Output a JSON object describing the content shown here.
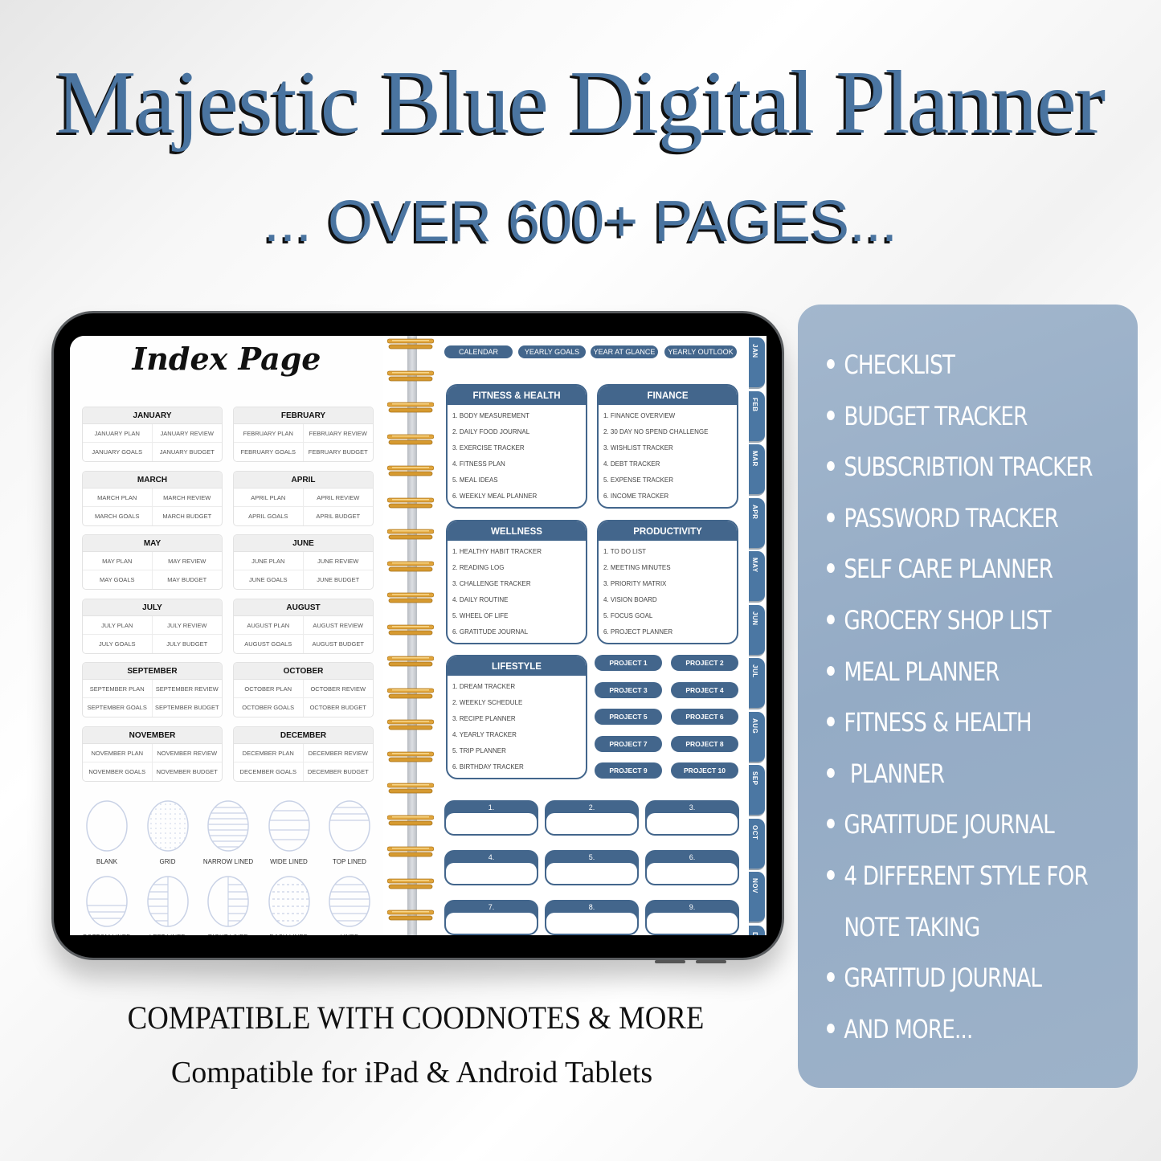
{
  "header": {
    "title": "Majestic Blue Digital Planner",
    "subtitle": "... OVER 600+ PAGES..."
  },
  "colors": {
    "accent": "#43668c",
    "title_blue": "#4a74a0",
    "panel": "#9db2c9"
  },
  "index_page": {
    "title": "Index Page",
    "months": [
      {
        "name": "JANUARY",
        "items": [
          "JANUARY PLAN",
          "JANUARY REVIEW",
          "JANUARY GOALS",
          "JANUARY BUDGET"
        ]
      },
      {
        "name": "FEBRUARY",
        "items": [
          "FEBRUARY PLAN",
          "FEBRUARY REVIEW",
          "FEBRUARY GOALS",
          "FEBRUARY BUDGET"
        ]
      },
      {
        "name": "MARCH",
        "items": [
          "MARCH PLAN",
          "MARCH REVIEW",
          "MARCH GOALS",
          "MARCH BUDGET"
        ]
      },
      {
        "name": "APRIL",
        "items": [
          "APRIL PLAN",
          "APRIL REVIEW",
          "APRIL GOALS",
          "APRIL BUDGET"
        ]
      },
      {
        "name": "MAY",
        "items": [
          "MAY PLAN",
          "MAY REVIEW",
          "MAY GOALS",
          "MAY BUDGET"
        ]
      },
      {
        "name": "JUNE",
        "items": [
          "JUNE PLAN",
          "JUNE REVIEW",
          "JUNE GOALS",
          "JUNE BUDGET"
        ]
      },
      {
        "name": "JULY",
        "items": [
          "JULY PLAN",
          "JULY REVIEW",
          "JULY GOALS",
          "JULY BUDGET"
        ]
      },
      {
        "name": "AUGUST",
        "items": [
          "AUGUST PLAN",
          "AUGUST REVIEW",
          "AUGUST GOALS",
          "AUGUST BUDGET"
        ]
      },
      {
        "name": "SEPTEMBER",
        "items": [
          "SEPTEMBER PLAN",
          "SEPTEMBER REVIEW",
          "SEPTEMBER GOALS",
          "SEPTEMBER BUDGET"
        ]
      },
      {
        "name": "OCTOBER",
        "items": [
          "OCTOBER PLAN",
          "OCTOBER REVIEW",
          "OCTOBER GOALS",
          "OCTOBER BUDGET"
        ]
      },
      {
        "name": "NOVEMBER",
        "items": [
          "NOVEMBER PLAN",
          "NOVEMBER REVIEW",
          "NOVEMBER GOALS",
          "NOVEMBER BUDGET"
        ]
      },
      {
        "name": "DECEMBER",
        "items": [
          "DECEMBER PLAN",
          "DECEMBER REVIEW",
          "DECEMBER GOALS",
          "DECEMBER BUDGET"
        ]
      }
    ],
    "note_styles": [
      "BLANK",
      "GRID",
      "NARROW LINED",
      "WIDE LINED",
      "TOP LINED",
      "BOTTOM LINED",
      "LEFT LINED",
      "RIGHT LINED",
      "DASH LINED",
      "LINED"
    ]
  },
  "right_page": {
    "nav_buttons": [
      "CALENDAR",
      "YEARLY GOALS",
      "YEAR AT GLANCE",
      "YEARLY OUTLOOK"
    ],
    "categories": [
      {
        "title": "FITNESS & HEALTH",
        "items": [
          "1. BODY MEASUREMENT",
          "2. DAILY FOOD JOURNAL",
          "3. EXERCISE TRACKER",
          "4. FITNESS PLAN",
          "5. MEAL IDEAS",
          "6. WEEKLY MEAL PLANNER"
        ]
      },
      {
        "title": "FINANCE",
        "items": [
          "1. FINANCE OVERVIEW",
          "2. 30 DAY NO SPEND CHALLENGE",
          "3. WISHLIST TRACKER",
          "4. DEBT TRACKER",
          "5. EXPENSE TRACKER",
          "6. INCOME TRACKER"
        ]
      },
      {
        "title": "WELLNESS",
        "items": [
          "1. HEALTHY HABIT TRACKER",
          "2. READING LOG",
          "3. CHALLENGE TRACKER",
          "4. DAILY ROUTINE",
          "5. WHEEL OF LIFE",
          "6. GRATITUDE JOURNAL"
        ]
      },
      {
        "title": "PRODUCTIVITY",
        "items": [
          "1. TO DO LIST",
          "2. MEETING MINUTES",
          "3. PRIORITY MATRIX",
          "4. VISION BOARD",
          "5. FOCUS GOAL",
          "6. PROJECT PLANNER"
        ]
      },
      {
        "title": "LIFESTYLE",
        "items": [
          "1. DREAM TRACKER",
          "2. WEEKLY SCHEDULE",
          "3. RECIPE PLANNER",
          "4. YEARLY TRACKER",
          "5. TRIP PLANNER",
          "6. BIRTHDAY TRACKER"
        ]
      }
    ],
    "projects": [
      "PROJECT 1",
      "PROJECT 2",
      "PROJECT 3",
      "PROJECT 4",
      "PROJECT 5",
      "PROJECT 6",
      "PROJECT 7",
      "PROJECT 8",
      "PROJECT 9",
      "PROJECT 10"
    ],
    "notes": [
      "1.",
      "2.",
      "3.",
      "4.",
      "5.",
      "6.",
      "7.",
      "8.",
      "9."
    ],
    "month_tabs": [
      "JAN",
      "FEB",
      "MAR",
      "APR",
      "MAY",
      "JUN",
      "JUL",
      "AUG",
      "SEP",
      "OCT",
      "NOV",
      "DEC"
    ]
  },
  "features": [
    {
      "label": "CHECKLIST",
      "bullet": true
    },
    {
      "label": "BUDGET TRACKER",
      "bullet": true
    },
    {
      "label": "SUBSCRIBTION TRACKER",
      "bullet": true
    },
    {
      "label": "PASSWORD TRACKER",
      "bullet": true
    },
    {
      "label": "SELF CARE PLANNER",
      "bullet": true
    },
    {
      "label": "GROCERY SHOP LIST",
      "bullet": true
    },
    {
      "label": "MEAL PLANNER",
      "bullet": true
    },
    {
      "label": "FITNESS & HEALTH",
      "bullet": true
    },
    {
      "label": " PLANNER",
      "bullet": true
    },
    {
      "label": "GRATITUDE JOURNAL",
      "bullet": true
    },
    {
      "label": "4 DIFFERENT STYLE FOR",
      "bullet": true
    },
    {
      "label": "NOTE TAKING",
      "bullet": false
    },
    {
      "label": "GRATITUD JOURNAL",
      "bullet": true
    },
    {
      "label": "AND MORE...",
      "bullet": true
    }
  ],
  "footer": {
    "compat_line1": "COMPATIBLE WITH COODNOTES & MORE",
    "compat_line2": "Compatible for iPad & Android Tablets"
  }
}
